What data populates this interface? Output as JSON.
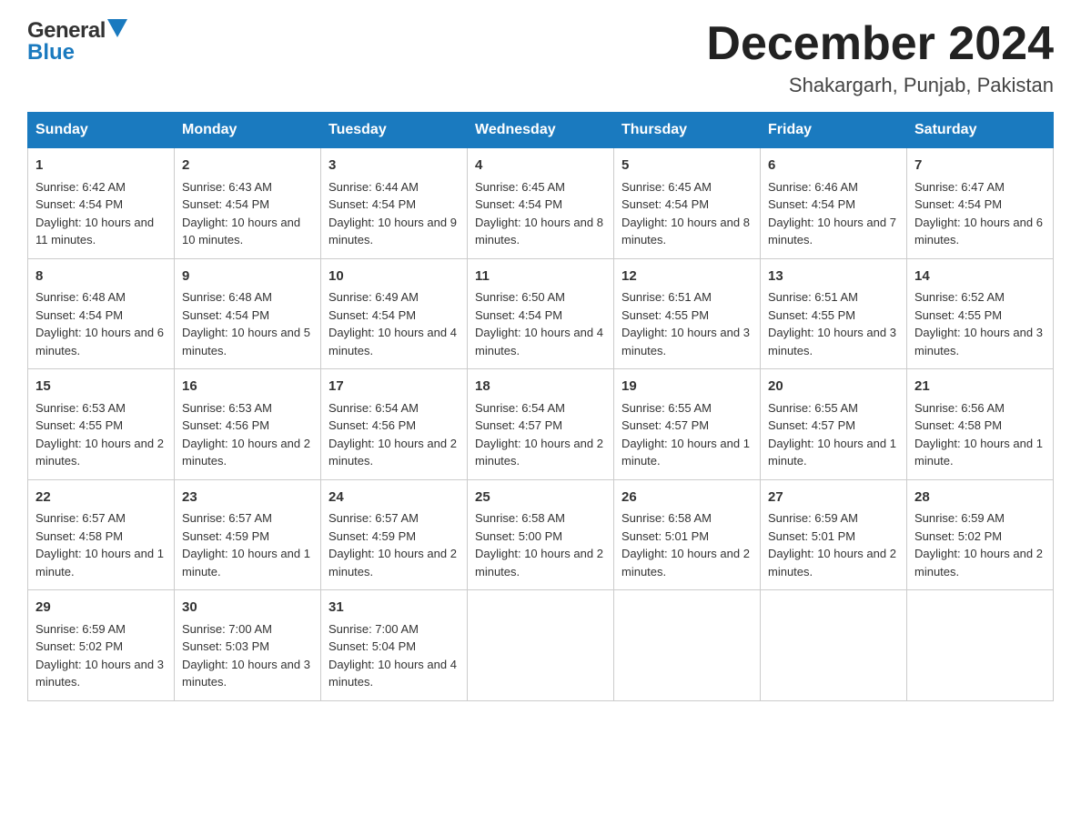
{
  "header": {
    "logo_general": "General",
    "logo_blue": "Blue",
    "month_title": "December 2024",
    "location": "Shakargarh, Punjab, Pakistan"
  },
  "days_of_week": [
    "Sunday",
    "Monday",
    "Tuesday",
    "Wednesday",
    "Thursday",
    "Friday",
    "Saturday"
  ],
  "weeks": [
    [
      {
        "day": "1",
        "sunrise": "6:42 AM",
        "sunset": "4:54 PM",
        "daylight": "10 hours and 11 minutes."
      },
      {
        "day": "2",
        "sunrise": "6:43 AM",
        "sunset": "4:54 PM",
        "daylight": "10 hours and 10 minutes."
      },
      {
        "day": "3",
        "sunrise": "6:44 AM",
        "sunset": "4:54 PM",
        "daylight": "10 hours and 9 minutes."
      },
      {
        "day": "4",
        "sunrise": "6:45 AM",
        "sunset": "4:54 PM",
        "daylight": "10 hours and 8 minutes."
      },
      {
        "day": "5",
        "sunrise": "6:45 AM",
        "sunset": "4:54 PM",
        "daylight": "10 hours and 8 minutes."
      },
      {
        "day": "6",
        "sunrise": "6:46 AM",
        "sunset": "4:54 PM",
        "daylight": "10 hours and 7 minutes."
      },
      {
        "day": "7",
        "sunrise": "6:47 AM",
        "sunset": "4:54 PM",
        "daylight": "10 hours and 6 minutes."
      }
    ],
    [
      {
        "day": "8",
        "sunrise": "6:48 AM",
        "sunset": "4:54 PM",
        "daylight": "10 hours and 6 minutes."
      },
      {
        "day": "9",
        "sunrise": "6:48 AM",
        "sunset": "4:54 PM",
        "daylight": "10 hours and 5 minutes."
      },
      {
        "day": "10",
        "sunrise": "6:49 AM",
        "sunset": "4:54 PM",
        "daylight": "10 hours and 4 minutes."
      },
      {
        "day": "11",
        "sunrise": "6:50 AM",
        "sunset": "4:54 PM",
        "daylight": "10 hours and 4 minutes."
      },
      {
        "day": "12",
        "sunrise": "6:51 AM",
        "sunset": "4:55 PM",
        "daylight": "10 hours and 3 minutes."
      },
      {
        "day": "13",
        "sunrise": "6:51 AM",
        "sunset": "4:55 PM",
        "daylight": "10 hours and 3 minutes."
      },
      {
        "day": "14",
        "sunrise": "6:52 AM",
        "sunset": "4:55 PM",
        "daylight": "10 hours and 3 minutes."
      }
    ],
    [
      {
        "day": "15",
        "sunrise": "6:53 AM",
        "sunset": "4:55 PM",
        "daylight": "10 hours and 2 minutes."
      },
      {
        "day": "16",
        "sunrise": "6:53 AM",
        "sunset": "4:56 PM",
        "daylight": "10 hours and 2 minutes."
      },
      {
        "day": "17",
        "sunrise": "6:54 AM",
        "sunset": "4:56 PM",
        "daylight": "10 hours and 2 minutes."
      },
      {
        "day": "18",
        "sunrise": "6:54 AM",
        "sunset": "4:57 PM",
        "daylight": "10 hours and 2 minutes."
      },
      {
        "day": "19",
        "sunrise": "6:55 AM",
        "sunset": "4:57 PM",
        "daylight": "10 hours and 1 minute."
      },
      {
        "day": "20",
        "sunrise": "6:55 AM",
        "sunset": "4:57 PM",
        "daylight": "10 hours and 1 minute."
      },
      {
        "day": "21",
        "sunrise": "6:56 AM",
        "sunset": "4:58 PM",
        "daylight": "10 hours and 1 minute."
      }
    ],
    [
      {
        "day": "22",
        "sunrise": "6:57 AM",
        "sunset": "4:58 PM",
        "daylight": "10 hours and 1 minute."
      },
      {
        "day": "23",
        "sunrise": "6:57 AM",
        "sunset": "4:59 PM",
        "daylight": "10 hours and 1 minute."
      },
      {
        "day": "24",
        "sunrise": "6:57 AM",
        "sunset": "4:59 PM",
        "daylight": "10 hours and 2 minutes."
      },
      {
        "day": "25",
        "sunrise": "6:58 AM",
        "sunset": "5:00 PM",
        "daylight": "10 hours and 2 minutes."
      },
      {
        "day": "26",
        "sunrise": "6:58 AM",
        "sunset": "5:01 PM",
        "daylight": "10 hours and 2 minutes."
      },
      {
        "day": "27",
        "sunrise": "6:59 AM",
        "sunset": "5:01 PM",
        "daylight": "10 hours and 2 minutes."
      },
      {
        "day": "28",
        "sunrise": "6:59 AM",
        "sunset": "5:02 PM",
        "daylight": "10 hours and 2 minutes."
      }
    ],
    [
      {
        "day": "29",
        "sunrise": "6:59 AM",
        "sunset": "5:02 PM",
        "daylight": "10 hours and 3 minutes."
      },
      {
        "day": "30",
        "sunrise": "7:00 AM",
        "sunset": "5:03 PM",
        "daylight": "10 hours and 3 minutes."
      },
      {
        "day": "31",
        "sunrise": "7:00 AM",
        "sunset": "5:04 PM",
        "daylight": "10 hours and 4 minutes."
      },
      null,
      null,
      null,
      null
    ]
  ],
  "labels": {
    "sunrise_prefix": "Sunrise: ",
    "sunset_prefix": "Sunset: ",
    "daylight_prefix": "Daylight: "
  }
}
